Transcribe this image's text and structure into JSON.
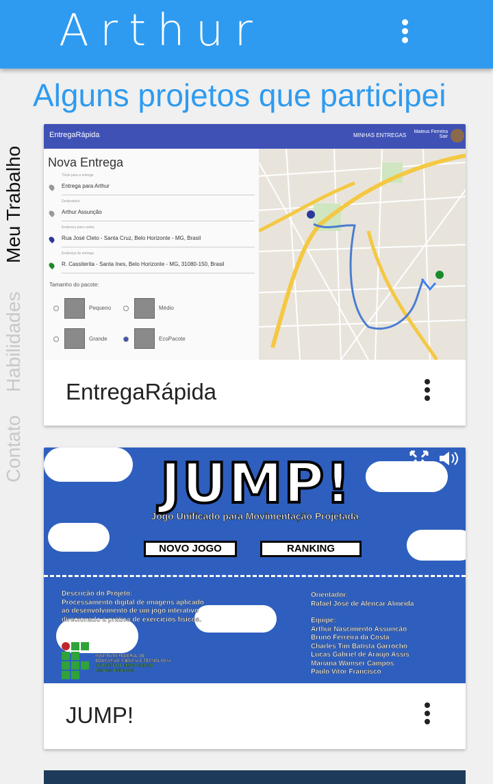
{
  "appbar": {
    "title": "Arthur",
    "menu_icon": "more-vert-icon"
  },
  "heading": "Alguns projetos que participei",
  "sidetabs": [
    {
      "label": "Meu Trabalho",
      "active": true,
      "color": "#111111"
    },
    {
      "label": "Habilidades",
      "active": false,
      "color": "#c8c8c8"
    },
    {
      "label": "Contato",
      "active": false,
      "color": "#c8c8c8"
    }
  ],
  "cards": [
    {
      "title": "EntregaRápida",
      "screenshot": {
        "brand": "EntregaRápida",
        "nav": "MINHAS ENTREGAS",
        "user_name": "Mateus Ferreira",
        "user_action": "Sair",
        "form_title": "Nova Entrega",
        "fields": [
          {
            "label": "Título para a entrega",
            "value": "Entrega para Arthur"
          },
          {
            "label": "Destinatário",
            "value": "Arthur Assunção"
          },
          {
            "label": "Endereço para coleta",
            "value": "Rua José Cleto - Santa Cruz, Belo Horizonte - MG, Brasil"
          },
          {
            "label": "Endereço de entrega",
            "value": "R. Cassiterita - Santa Ines, Belo Horizonte - MG, 31080-150, Brasil"
          }
        ],
        "package_label": "Tamanho do pacote:",
        "packages": [
          "Pequeno",
          "Médio",
          "Grande",
          "EcoPacote"
        ]
      }
    },
    {
      "title": "JUMP!",
      "screenshot": {
        "logo": "JUMP!",
        "subtitle": "Jogo Unificado para Movimentação Projetada",
        "buttons": [
          "NOVO JOGO",
          "RANKING"
        ],
        "description_title": "Descrição do Projeto:",
        "description": [
          "Processamento digital de imagens aplicado",
          "ao desenvolvimento de um jogo interativo",
          "direcionado à prática de exercícios físicos."
        ],
        "advisor_title": "Orientador:",
        "advisor": "Rafael José de Alencar Almeida",
        "team_title": "Equipe:",
        "team": [
          "Arthur Nascimento Assunção",
          "Bruno Ferreira da Costa",
          "Charles Tim Batista Garrocho",
          "Lucas Gabriel de Araújo Assis",
          "Mariana Wamser Campos",
          "Paulo Vitor Francisco"
        ],
        "institute": [
          "INSTITUTO FEDERAL DE",
          "EDUCAÇÃO, CIÊNCIA E TECNOLOGIA",
          "SUDESTE DE MINAS GERAIS",
          "Campus Barbacena"
        ]
      }
    }
  ]
}
